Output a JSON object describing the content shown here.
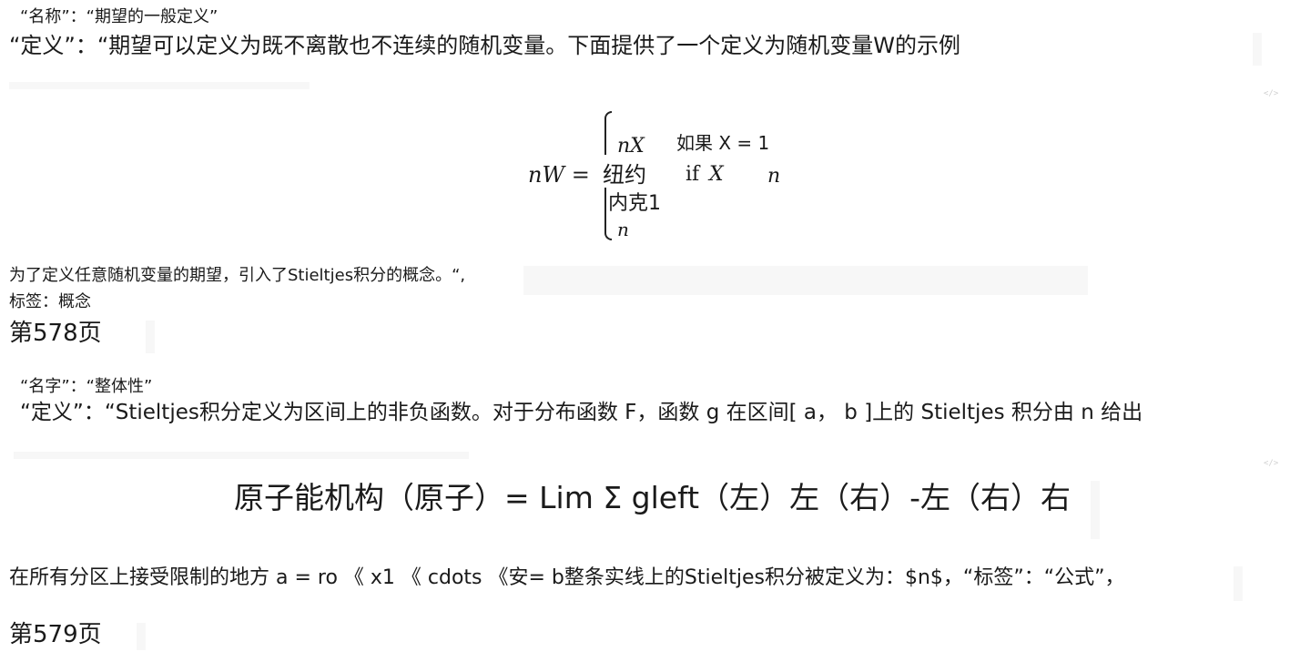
{
  "section1": {
    "name_line": "“名称”：“期望的一般定义”",
    "definition_line": "“定义”：“期望可以定义为既不离散也不连续的随机变量。下面提供了一个定义为随机变量W的示例",
    "formula": {
      "lhs": "nW =",
      "case1_expr": "nX",
      "case1_cond": "如果 X = 1",
      "case2_expr": "纽约",
      "case2_cond_prefix": "if",
      "case2_cond_var": "X",
      "case2_trailing": "n",
      "case3_expr": "内克1",
      "case4_expr": "n"
    },
    "stieltjes_intro": "为了定义任意随机变量的期望，引入了Stieltjes积分的概念。“,",
    "tag_line": "标签：概念",
    "page_label": "第578页"
  },
  "section2": {
    "name_line": "“名字”：“整体性”",
    "definition_line": "“定义”：“Stieltjes积分定义为区间上的非负函数。对于分布函数 F，函数 g 在区间[ a， b ]上的 Stieltjes 积分由 n 给出",
    "formula_line": "原子能机构（原子）= Lim Σ gleft（左）左（右）-左（右）右",
    "partition_line": "在所有分区上接受限制的地方 a = ro 《 x1 《 cdots 《安= b整条实线上的Stieltjes积分被定义为：$n$，“标签”：“公式”，",
    "page_label": "第579页"
  },
  "markers": [
    "</>",
    "</>"
  ]
}
